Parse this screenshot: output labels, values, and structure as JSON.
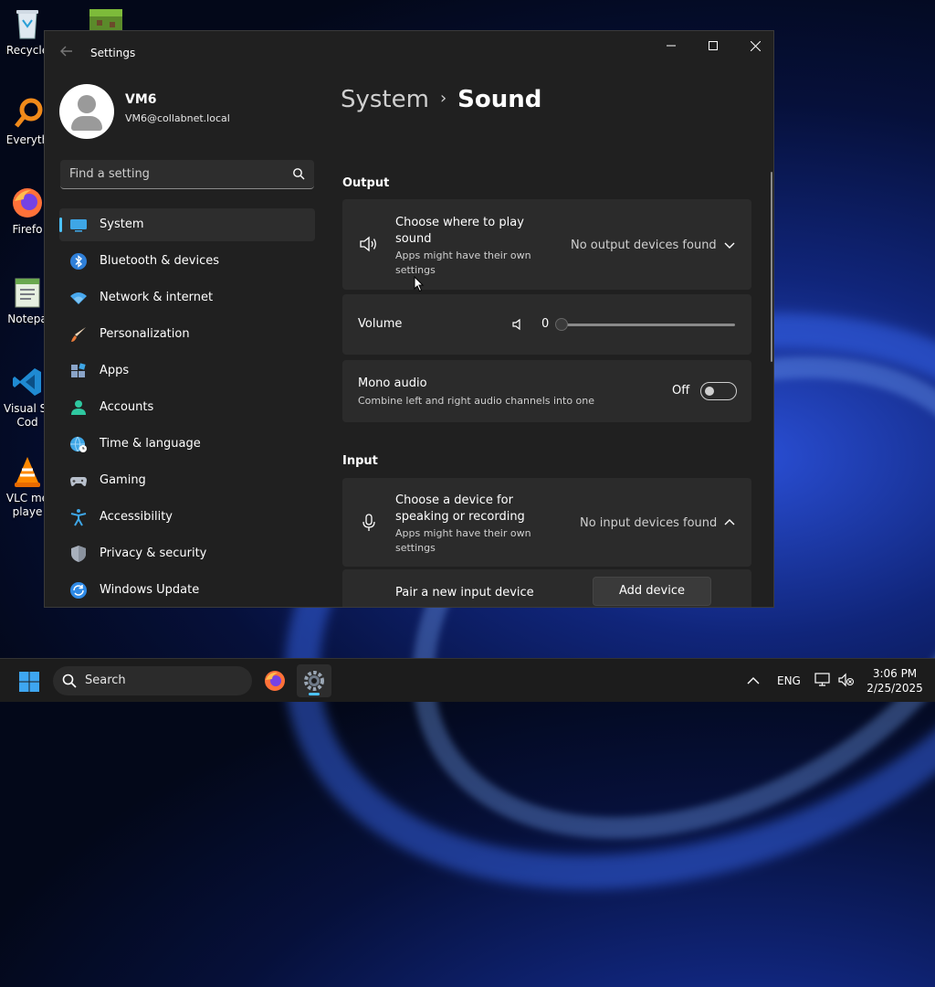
{
  "desktop": {
    "icons": [
      {
        "label": "Recycle",
        "icon": "recycle-bin-icon"
      },
      {
        "label": "",
        "icon": "minecraft-icon"
      },
      {
        "label": "Everyth",
        "icon": "everything-search-icon"
      },
      {
        "label": "Firefo",
        "icon": "firefox-icon"
      },
      {
        "label": "Notepa",
        "icon": "notepad-icon"
      },
      {
        "label": "Visual St\nCod",
        "icon": "vscode-icon"
      },
      {
        "label": "VLC me\nplaye",
        "icon": "vlc-icon"
      }
    ]
  },
  "window": {
    "title": "Settings",
    "controls": {
      "minimize": "minimize-icon",
      "maximize": "maximize-icon",
      "close": "close-icon"
    }
  },
  "profile": {
    "name": "VM6",
    "email": "VM6@collabnet.local"
  },
  "search": {
    "placeholder": "Find a setting"
  },
  "nav": {
    "items": [
      {
        "label": "System",
        "icon": "system-icon",
        "active": true
      },
      {
        "label": "Bluetooth & devices",
        "icon": "bluetooth-icon"
      },
      {
        "label": "Network & internet",
        "icon": "network-icon"
      },
      {
        "label": "Personalization",
        "icon": "brush-icon"
      },
      {
        "label": "Apps",
        "icon": "apps-icon"
      },
      {
        "label": "Accounts",
        "icon": "accounts-icon"
      },
      {
        "label": "Time & language",
        "icon": "globe-clock-icon"
      },
      {
        "label": "Gaming",
        "icon": "gamepad-icon"
      },
      {
        "label": "Accessibility",
        "icon": "accessibility-icon"
      },
      {
        "label": "Privacy & security",
        "icon": "shield-icon"
      },
      {
        "label": "Windows Update",
        "icon": "update-icon"
      }
    ]
  },
  "breadcrumb": {
    "parent": "System",
    "separator": "›",
    "current": "Sound"
  },
  "output": {
    "section_title": "Output",
    "device": {
      "title": "Choose where to play sound",
      "subtitle": "Apps might have their own settings",
      "value": "No output devices found"
    },
    "volume": {
      "label": "Volume",
      "value": "0",
      "level": 0
    },
    "mono": {
      "title": "Mono audio",
      "subtitle": "Combine left and right audio channels into one",
      "state": "Off"
    }
  },
  "input": {
    "section_title": "Input",
    "device": {
      "title": "Choose a device for speaking or recording",
      "subtitle": "Apps might have their own settings",
      "value": "No input devices found"
    },
    "pair": {
      "label": "Pair a new input device",
      "button": "Add device"
    }
  },
  "taskbar": {
    "search_label": "Search",
    "language": "ENG",
    "time": "3:06 PM",
    "date": "2/25/2025"
  },
  "colors": {
    "accent": "#4cc2ff",
    "window_bg": "#202020",
    "card_bg": "#2b2b2b"
  }
}
